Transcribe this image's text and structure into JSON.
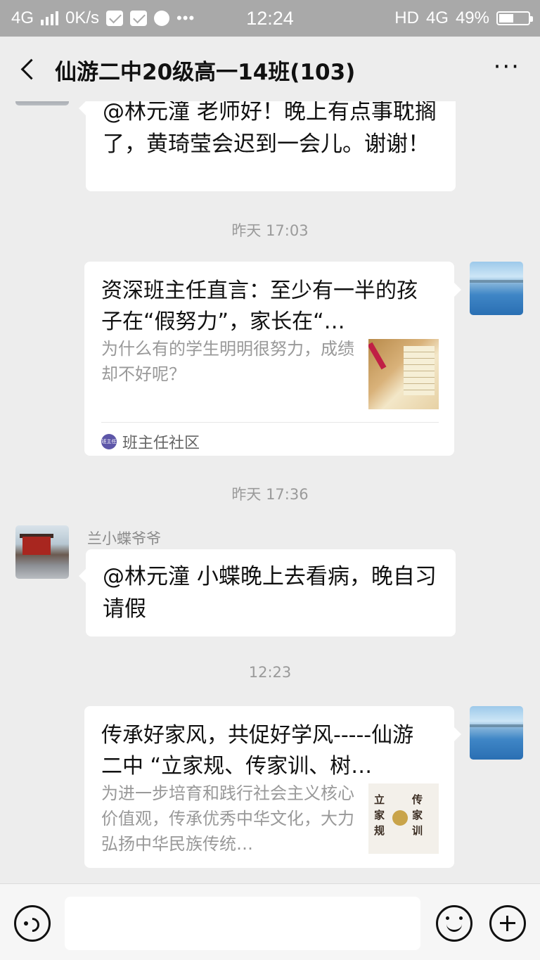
{
  "status_bar": {
    "network_left": "4G",
    "speed": "0K/s",
    "time": "12:24",
    "hd_label": "HD",
    "network_right": "4G",
    "battery_percent": "49%",
    "battery_level": 0.49,
    "icons": [
      "signal-icon",
      "notification-icon",
      "notification-icon",
      "app-icon",
      "more-icon",
      "battery-icon"
    ]
  },
  "header": {
    "title": "仙游二中20级高一14班(103)",
    "back_icon": "chevron-left-icon",
    "more_label": "···"
  },
  "messages": [
    {
      "type": "text",
      "side": "left",
      "text": "@林元潼 老师好！晚上有点事耽搁了，黄琦莹会迟到一会儿。谢谢！"
    },
    {
      "type": "time",
      "text": "昨天 17:03"
    },
    {
      "type": "card",
      "side": "right",
      "title": "资深班主任直言：至少有一半的孩子在“假努力”，家长在“…",
      "desc": "为什么有的学生明明很努力，成绩却不好呢？",
      "source": "班主任社区",
      "source_logo_text": "班主任"
    },
    {
      "type": "time",
      "text": "昨天 17:36"
    },
    {
      "type": "text",
      "side": "left",
      "sender": "兰小蝶爷爷",
      "text": "@林元潼  小蝶晚上去看病，晚自习请假"
    },
    {
      "type": "time",
      "text": "12:23"
    },
    {
      "type": "card",
      "side": "right",
      "title": "传承好家风，共促好学风-----仙游二中 “立家规、传家训、树…",
      "desc": "为进一步培育和践行社会主义核心价值观，传承优秀中华文化，大力弘扬中华民族传统…",
      "thumb_text": [
        "立",
        "家",
        "规",
        "传",
        "家",
        "训"
      ]
    }
  ],
  "input_bar": {
    "voice_icon": "voice-icon",
    "emoji_icon": "emoji-icon",
    "plus_icon": "plus-icon"
  }
}
